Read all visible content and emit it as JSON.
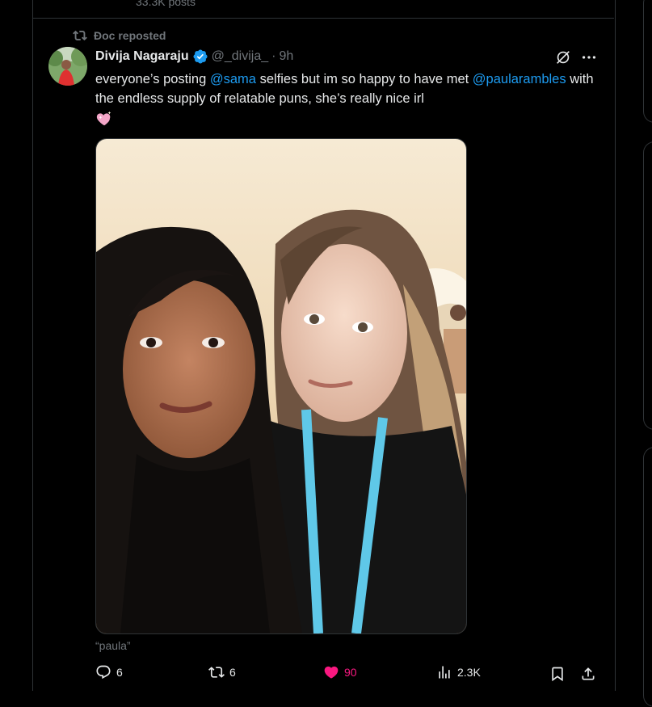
{
  "previous": {
    "posts_count": "33.3K posts"
  },
  "repost": {
    "label": "Đoc reposted"
  },
  "author": {
    "name": "Divija Nagaraju",
    "handle": "@_divija_",
    "time": "9h"
  },
  "post": {
    "text_part1": "everyone’s posting ",
    "mention1": "@sama",
    "text_part2": " selfies but im so happy to have met ",
    "mention2": "@paularambles",
    "text_part3": " with the endless supply of relatable puns, she’s really nice irl",
    "emoji": "sparkling-heart",
    "image_alt": "“paula”"
  },
  "stats": {
    "replies": "6",
    "reposts": "6",
    "likes": "90",
    "views": "2.3K"
  },
  "colors": {
    "accent": "#1d9bf0",
    "like": "#f91880",
    "muted": "#71767b",
    "lanyard": "#5fc8e8"
  },
  "icons": [
    "repost-icon",
    "verified-badge-icon",
    "grok-icon",
    "more-icon",
    "reply-icon",
    "like-icon",
    "views-icon",
    "bookmark-icon",
    "share-icon"
  ]
}
